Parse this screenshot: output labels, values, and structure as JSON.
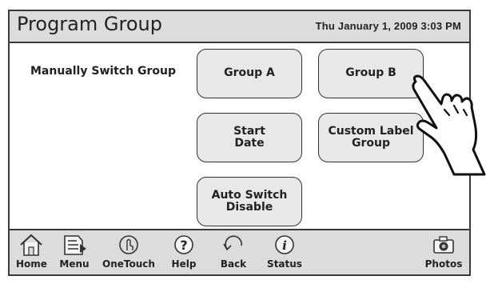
{
  "header": {
    "title": "Program Group",
    "datetime": "Thu January 1, 2009  3:03 PM"
  },
  "main": {
    "section_label": "Manually Switch Group",
    "buttons": {
      "group_a": "Group A",
      "group_b": "Group B",
      "start_date": "Start\nDate",
      "custom_label": "Custom Label\nGroup",
      "auto_switch": "Auto Switch\nDisable"
    }
  },
  "nav": {
    "items": [
      {
        "label": "Home",
        "icon": "house-icon"
      },
      {
        "label": "Menu",
        "icon": "menu-icon"
      },
      {
        "label": "OneTouch",
        "icon": "touch-icon"
      },
      {
        "label": "Help",
        "icon": "help-icon"
      },
      {
        "label": "Back",
        "icon": "back-icon"
      },
      {
        "label": "Status",
        "icon": "info-icon"
      },
      {
        "label": "Photos",
        "icon": "camera-icon"
      }
    ]
  },
  "overlay": {
    "icon": "pointing-hand-icon"
  }
}
